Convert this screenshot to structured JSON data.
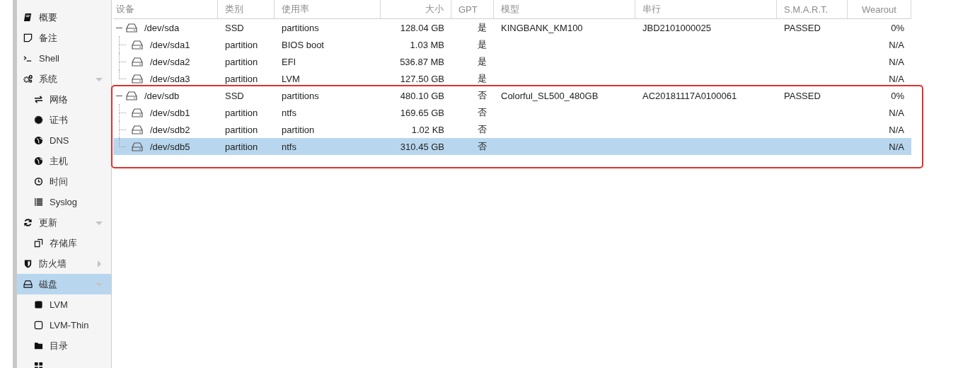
{
  "sidebar": {
    "items": [
      {
        "label": "概要",
        "kind": "book"
      },
      {
        "label": "备注",
        "kind": "note"
      },
      {
        "label": "Shell",
        "kind": "terminal"
      },
      {
        "label": "系统",
        "kind": "gears",
        "expanded": true,
        "selected": false,
        "children": [
          {
            "label": "网络",
            "kind": "arrows"
          },
          {
            "label": "证书",
            "kind": "cert"
          },
          {
            "label": "DNS",
            "kind": "globe"
          },
          {
            "label": "主机",
            "kind": "globe"
          },
          {
            "label": "时间",
            "kind": "clock"
          },
          {
            "label": "Syslog",
            "kind": "list"
          }
        ]
      },
      {
        "label": "更新",
        "kind": "refresh",
        "expanded": true,
        "selected": false,
        "children": [
          {
            "label": "存储库",
            "kind": "copy"
          }
        ]
      },
      {
        "label": "防火墙",
        "kind": "shield",
        "expanded": false,
        "selected": false
      },
      {
        "label": "磁盘",
        "kind": "disk",
        "expanded": true,
        "selected": true,
        "children": [
          {
            "label": "LVM",
            "kind": "square"
          },
          {
            "label": "LVM-Thin",
            "kind": "square-outline"
          },
          {
            "label": "目录",
            "kind": "folder"
          },
          {
            "kind": "grid"
          }
        ]
      }
    ]
  },
  "table": {
    "columns": [
      "设备",
      "类别",
      "使用率",
      "大小",
      "GPT",
      "模型",
      "串行",
      "S.M.A.R.T.",
      "Wearout"
    ],
    "rows": [
      {
        "device": "/dev/sda",
        "type": "SSD",
        "usage": "partitions",
        "size": "128.04 GB",
        "gpt": "是",
        "model": "KINGBANK_KM100",
        "serial": "JBD2101000025",
        "smart": "PASSED",
        "wearout": "0%",
        "expanded": true,
        "selected": false,
        "children": [
          {
            "device": "/dev/sda1",
            "type": "partition",
            "usage": "BIOS boot",
            "size": "1.03 MB",
            "gpt": "是",
            "wearout": "N/A",
            "selected": false
          },
          {
            "device": "/dev/sda2",
            "type": "partition",
            "usage": "EFI",
            "size": "536.87 MB",
            "gpt": "是",
            "wearout": "N/A",
            "selected": false
          },
          {
            "device": "/dev/sda3",
            "type": "partition",
            "usage": "LVM",
            "size": "127.50 GB",
            "gpt": "是",
            "wearout": "N/A",
            "selected": false
          }
        ]
      },
      {
        "device": "/dev/sdb",
        "type": "SSD",
        "usage": "partitions",
        "size": "480.10 GB",
        "gpt": "否",
        "model": "Colorful_SL500_480GB",
        "serial": "AC20181117A0100061",
        "smart": "PASSED",
        "wearout": "0%",
        "expanded": true,
        "selected": false,
        "children": [
          {
            "device": "/dev/sdb1",
            "type": "partition",
            "usage": "ntfs",
            "size": "169.65 GB",
            "gpt": "否",
            "wearout": "N/A",
            "selected": false
          },
          {
            "device": "/dev/sdb2",
            "type": "partition",
            "usage": "partition",
            "size": "1.02 KB",
            "gpt": "否",
            "wearout": "N/A",
            "selected": false
          },
          {
            "device": "/dev/sdb5",
            "type": "partition",
            "usage": "ntfs",
            "size": "310.45 GB",
            "gpt": "否",
            "wearout": "N/A",
            "selected": true
          }
        ]
      }
    ]
  }
}
